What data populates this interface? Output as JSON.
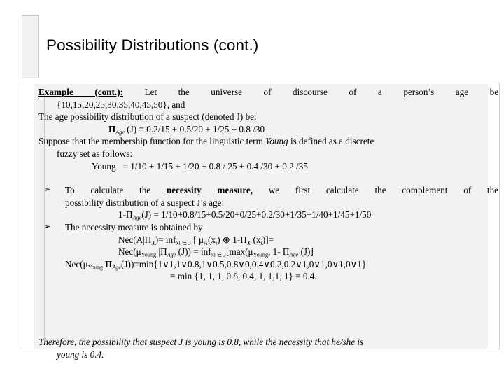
{
  "slide": {
    "title": "Possibility Distributions (cont.)",
    "colors": {
      "background": "#ffffff",
      "text": "#000000",
      "placeholder_fill": "#f2f2f2",
      "placeholder_border": "#cfcfcf"
    }
  },
  "body": {
    "example_label": "Example  (cont.):",
    "intro_words": [
      "Let",
      "the",
      "universe",
      "of",
      "discourse",
      "of",
      "a",
      "person’s",
      "age",
      "be"
    ],
    "universe_set": "{10,15,20,25,30,35,40,45,50}, and",
    "line_distribution_intro": "The age possibility distribution of a suspect (denoted J) be:",
    "formula_pi_age_lhs": "Π",
    "formula_pi_age_sub": "Age",
    "formula_pi_age_rhs": "(J) = 0.2/15 + 0.5/20 + 1/25 + 0.8 /30",
    "suppose_pre": "Suppose that the membership function for the linguistic term ",
    "suppose_italic": "Young",
    "suppose_post": " is defined as a discrete",
    "suppose_cont": "fuzzy set as follows:",
    "young_label": "Young",
    "young_value": "= 1/10 + 1/15 + 1/20 + 0.8 / 25 + 0.4 /30 + 0.2 /35",
    "bullet_glyph": "➢",
    "bullet1_words": [
      "To",
      "calculate",
      "the"
    ],
    "bullet1_bold": "necessity measure,",
    "bullet1_words2": [
      "we",
      "first",
      "calculate",
      "the",
      "complement",
      "of",
      "the"
    ],
    "bullet1_cont": "possibility distribution of a suspect J’s age:",
    "complement_lhs": "1-Π",
    "complement_sub": "Age",
    "complement_rhs": "(J) = 1/10+0.8/15+0.5/20+0/25+0.2/30+1/35+1/40+1/45+1/50",
    "bullet2": "The necessity measure is obtained by",
    "nec_line1_a": "Nec(A|Π",
    "nec_line1_sub1": "X",
    "nec_line1_b": ")= inf",
    "nec_line1_sub2": "xi ∈U",
    "nec_line1_c": " [ μ",
    "nec_line1_sub3": "A",
    "nec_line1_d": "(x",
    "nec_line1_sub4": "i",
    "nec_line1_e": ") ⊕ 1-Π",
    "nec_line1_sub5": "X",
    "nec_line1_f": " (x",
    "nec_line1_sub6": "i",
    "nec_line1_g": ")]=",
    "nec_line2_a": "Nec(μ",
    "nec_line2_sub1": "Young",
    "nec_line2_b": " |Π",
    "nec_line2_sub2": "Age",
    "nec_line2_c": " (J)) = inf",
    "nec_line2_sub3": "xi ∈U",
    "nec_line2_d": "[max(μ",
    "nec_line2_sub4": "Young",
    "nec_line2_e": ", 1- Π",
    "nec_line2_sub5": "Age",
    "nec_line2_f": " (J)]",
    "nec_line3_a": "Nec(μ",
    "nec_line3_sub1": "Young",
    "nec_line3_b": "|Π",
    "nec_line3_sub2": "Age",
    "nec_line3_c": "(J))=min{1∨1,1∨0.8,1∨0.5,0.8∨0,0.4∨0.2,0.2∨1,0∨1,0∨1,0∨1}",
    "nec_line4": "= min {1, 1, 1, 0.8, 0.4, 1, 1,1, 1} = 0.4."
  },
  "conclusion": {
    "line1": "Therefore, the possibility that suspect J is young is 0.8, while the necessity that he/she is",
    "line2": "young is 0.4."
  }
}
